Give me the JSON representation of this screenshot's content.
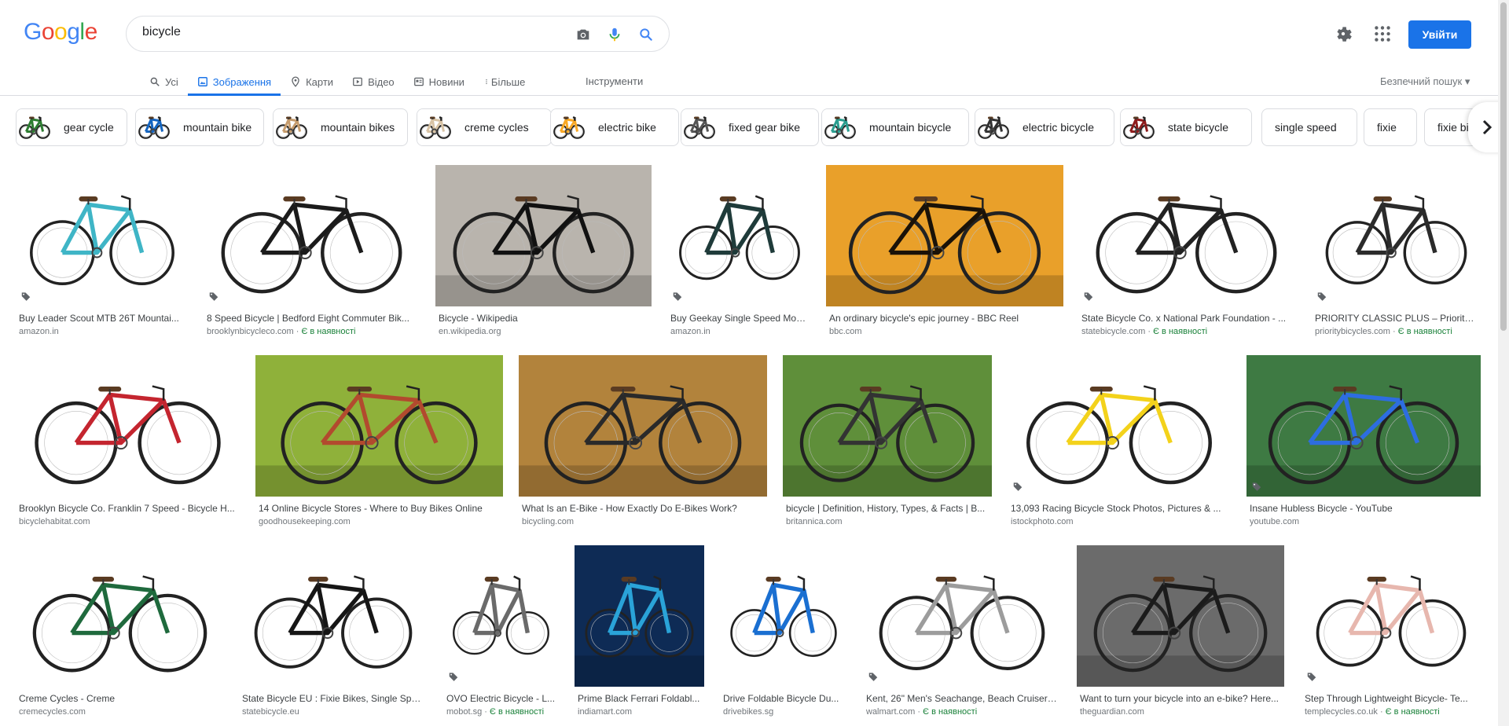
{
  "logo": {
    "letters": [
      "G",
      "o",
      "o",
      "g",
      "l",
      "e"
    ],
    "colors": [
      "#4285f4",
      "#ea4335",
      "#fbbc05",
      "#4285f4",
      "#34a853",
      "#ea4335"
    ]
  },
  "search": {
    "value": "bicycle"
  },
  "header": {
    "signin_label": "Увійти"
  },
  "tabs": [
    {
      "label": "Усі",
      "icon": "search-icon"
    },
    {
      "label": "Зображення",
      "icon": "image-icon",
      "active": true
    },
    {
      "label": "Карти",
      "icon": "map-pin-icon"
    },
    {
      "label": "Відео",
      "icon": "video-icon"
    },
    {
      "label": "Новини",
      "icon": "news-icon"
    },
    {
      "label": "Більше",
      "icon": "more-vert-icon"
    }
  ],
  "tools_label": "Інструменти",
  "safesearch_label": "Безпечний пошук",
  "chips": [
    {
      "label": "gear cycle",
      "thumb": true
    },
    {
      "label": "mountain bike",
      "thumb": true
    },
    {
      "label": "mountain bikes",
      "thumb": true
    },
    {
      "label": "creme cycles",
      "thumb": true
    },
    {
      "label": "electric bike",
      "thumb": true
    },
    {
      "label": "fixed gear bike",
      "thumb": true
    },
    {
      "label": "mountain bicycle",
      "thumb": true
    },
    {
      "label": "electric bicycle",
      "thumb": true
    },
    {
      "label": "state bicycle",
      "thumb": true
    },
    {
      "label": "single speed",
      "thumb": false
    },
    {
      "label": "fixie",
      "thumb": false
    },
    {
      "label": "fixie bike",
      "thumb": false
    }
  ],
  "colors": {
    "accent": "#1a73e8",
    "in_stock": "#188038"
  },
  "results": [
    {
      "title": "Buy Leader Scout MTB 26T Mountai...",
      "source": "amazon.in",
      "stock": "",
      "tag": true,
      "frame": "#3fb5c6",
      "bg": "#ffffff"
    },
    {
      "title": "8 Speed Bicycle | Bedford Eight Commuter Bik...",
      "source": "brooklynbicycleco.com",
      "stock": "Є в наявності",
      "tag": true,
      "frame": "#1b1b1b",
      "bg": "#ffffff"
    },
    {
      "title": "Bicycle - Wikipedia",
      "source": "en.wikipedia.org",
      "stock": "",
      "tag": false,
      "frame": "#111111",
      "bg": "#b9b4ad"
    },
    {
      "title": "Buy Geekay Single Speed Mou...",
      "source": "amazon.in",
      "stock": "",
      "tag": true,
      "frame": "#1f3b3a",
      "bg": "#ffffff"
    },
    {
      "title": "An ordinary bicycle's epic journey - BBC Reel",
      "source": "bbc.com",
      "stock": "",
      "tag": false,
      "frame": "#1a1208",
      "bg": "#e9a02a"
    },
    {
      "title": "State Bicycle Co. x National Park Foundation - ...",
      "source": "statebicycle.com",
      "stock": "Є в наявності",
      "tag": true,
      "frame": "#222222",
      "bg": "#ffffff"
    },
    {
      "title": "PRIORITY CLASSIC PLUS – Priority ...",
      "source": "prioritybicycles.com",
      "stock": "Є в наявності",
      "tag": true,
      "frame": "#2b2b2b",
      "bg": "#ffffff"
    },
    {
      "title": "Brooklyn Bicycle Co. Franklin 7 Speed - Bicycle H...",
      "source": "bicyclehabitat.com",
      "stock": "",
      "tag": false,
      "frame": "#c4252f",
      "bg": "#ffffff"
    },
    {
      "title": "14 Online Bicycle Stores - Where to Buy Bikes Online",
      "source": "goodhousekeeping.com",
      "stock": "",
      "tag": false,
      "frame": "#b24a2e",
      "bg": "#8fb13a"
    },
    {
      "title": "What Is an E-Bike - How Exactly Do E-Bikes Work?",
      "source": "bicycling.com",
      "stock": "",
      "tag": false,
      "frame": "#2a2a2a",
      "bg": "#b2833c"
    },
    {
      "title": "bicycle | Definition, History, Types, & Facts | B...",
      "source": "britannica.com",
      "stock": "",
      "tag": false,
      "frame": "#333333",
      "bg": "#5f8f3a"
    },
    {
      "title": "13,093 Racing Bicycle Stock Photos, Pictures & ...",
      "source": "istockphoto.com",
      "stock": "",
      "tag": true,
      "frame": "#f3d21b",
      "bg": "#ffffff"
    },
    {
      "title": "Insane Hubless Bicycle - YouTube",
      "source": "youtube.com",
      "stock": "",
      "tag": true,
      "frame": "#2d6de0",
      "bg": "#3e7a43"
    },
    {
      "title": "Creme Cycles - Creme",
      "source": "cremecycles.com",
      "stock": "",
      "tag": false,
      "frame": "#1f6a3d",
      "bg": "#ffffff"
    },
    {
      "title": "State Bicycle EU : Fixie Bikes, Single Spe...",
      "source": "statebicycle.eu",
      "stock": "",
      "tag": false,
      "frame": "#161616",
      "bg": "#ffffff"
    },
    {
      "title": "OVO Electric Bicycle - L...",
      "source": "mobot.sg",
      "stock": "Є в наявності",
      "tag": true,
      "frame": "#6a6a6a",
      "bg": "#ffffff"
    },
    {
      "title": "Prime Black Ferrari Foldabl...",
      "source": "indiamart.com",
      "stock": "",
      "tag": false,
      "frame": "#2aa3d8",
      "bg": "#0e2b55"
    },
    {
      "title": "Drive Foldable Bicycle Du...",
      "source": "drivebikes.sg",
      "stock": "",
      "tag": false,
      "frame": "#1a6fd1",
      "bg": "#ffffff"
    },
    {
      "title": "Kent, 26\" Men's Seachange, Beach Cruiser ...",
      "source": "walmart.com",
      "stock": "Є в наявності",
      "tag": true,
      "frame": "#9c9c9c",
      "bg": "#ffffff"
    },
    {
      "title": "Want to turn your bicycle into an e-bike? Here...",
      "source": "theguardian.com",
      "stock": "",
      "tag": false,
      "frame": "#1b1b1b",
      "bg": "#6b6b6b"
    },
    {
      "title": "Step Through Lightweight Bicycle- Te...",
      "source": "templecycles.co.uk",
      "stock": "Є в наявності",
      "tag": true,
      "frame": "#e7b7ae",
      "bg": "#ffffff"
    }
  ]
}
